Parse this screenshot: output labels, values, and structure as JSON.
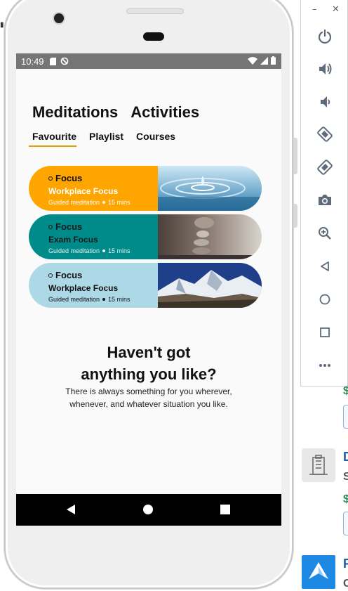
{
  "status_bar": {
    "time": "10:49"
  },
  "tabs_primary": [
    {
      "label": "Meditations"
    },
    {
      "label": "Activities"
    }
  ],
  "tabs_secondary": [
    {
      "label": "Favourite",
      "selected": true
    },
    {
      "label": "Playlist"
    },
    {
      "label": "Courses"
    }
  ],
  "cards": [
    {
      "category": "Focus",
      "title": "Workplace Focus",
      "type": "Guided meditation",
      "duration": "15 mins",
      "color": "#FFA500",
      "text_color": "#ffffff",
      "image": "water-drop"
    },
    {
      "category": "Focus",
      "title": "Exam Focus",
      "type": "Guided meditation",
      "duration": "15 mins",
      "color": "#008B8B",
      "text_color": "#1a1a1a",
      "image": "balanced-stones"
    },
    {
      "category": "Focus",
      "title": "Workplace Focus",
      "type": "Guided meditation",
      "duration": "15 mins",
      "color": "#ADD8E6",
      "text_color": "#111111",
      "image": "snowy-mountain"
    }
  ],
  "empty_state": {
    "title_line1": "Haven't got",
    "title_line2": "anything you like?",
    "desc_line1": "There is always something for you wherever,",
    "desc_line2": "whenever, and whatever situation you like."
  },
  "emulator_toolbar": {
    "items": [
      "power-icon",
      "volume-up-icon",
      "volume-down-icon",
      "rotate-left-icon",
      "rotate-right-icon",
      "camera-icon",
      "zoom-icon",
      "back-icon",
      "home-icon",
      "overview-icon",
      "more-icon"
    ]
  },
  "background_app": {
    "price_top": "$",
    "price_mid": "$",
    "title_mid": "D",
    "sub_mid": "S",
    "title_bottom": "F",
    "sub_bottom": "C"
  }
}
